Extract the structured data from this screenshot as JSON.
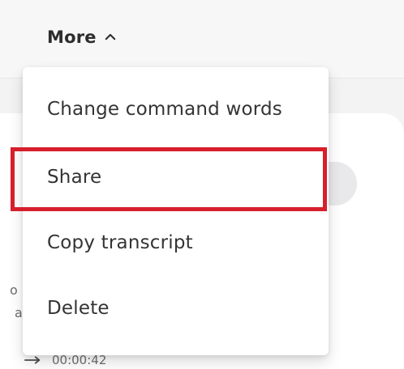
{
  "header": {
    "more_label": "More",
    "more_icon": "chevron-up-icon"
  },
  "menu": {
    "items": [
      {
        "label": "Change command words"
      },
      {
        "label": "Share"
      },
      {
        "label": "Copy transcript"
      },
      {
        "label": "Delete"
      }
    ]
  },
  "background": {
    "snippet_1": "o",
    "snippet_2": "a",
    "timestamp": "00:00:42",
    "timestamp_icon": "arrow-right-icon"
  },
  "colors": {
    "highlight": "#d61f2b",
    "text_primary": "#343434",
    "text_secondary": "#6e6e6e"
  }
}
